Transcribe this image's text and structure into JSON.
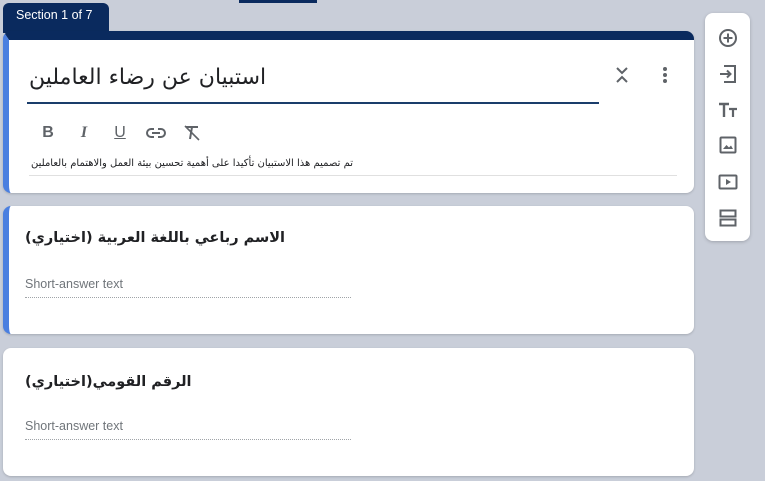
{
  "section_tab": {
    "label": "Section 1 of 7"
  },
  "form": {
    "title": "استبيان عن رضاء العاملين",
    "description": "تم تصميم هذا الاستبيان تأكيدا على أهمية تحسين بيئة العمل والاهتمام بالعاملين"
  },
  "toolbar": {
    "bold": "B",
    "italic": "I",
    "underline": "U",
    "link_icon": "link-icon",
    "clear_format_icon": "clear-formatting-icon"
  },
  "questions": [
    {
      "title": "الاسم رباعي باللغة العربية (اختياري)",
      "placeholder": "Short-answer text"
    },
    {
      "title": "الرقم القومي(اختياري)",
      "placeholder": "Short-answer text"
    }
  ],
  "side_toolbar": {
    "items": [
      "add-question-icon",
      "import-questions-icon",
      "add-title-icon",
      "add-image-icon",
      "add-video-icon",
      "add-section-icon"
    ]
  },
  "colors": {
    "accent": "#0a2a5e",
    "active_border": "#4a7fe0",
    "background": "#c9ced9"
  }
}
